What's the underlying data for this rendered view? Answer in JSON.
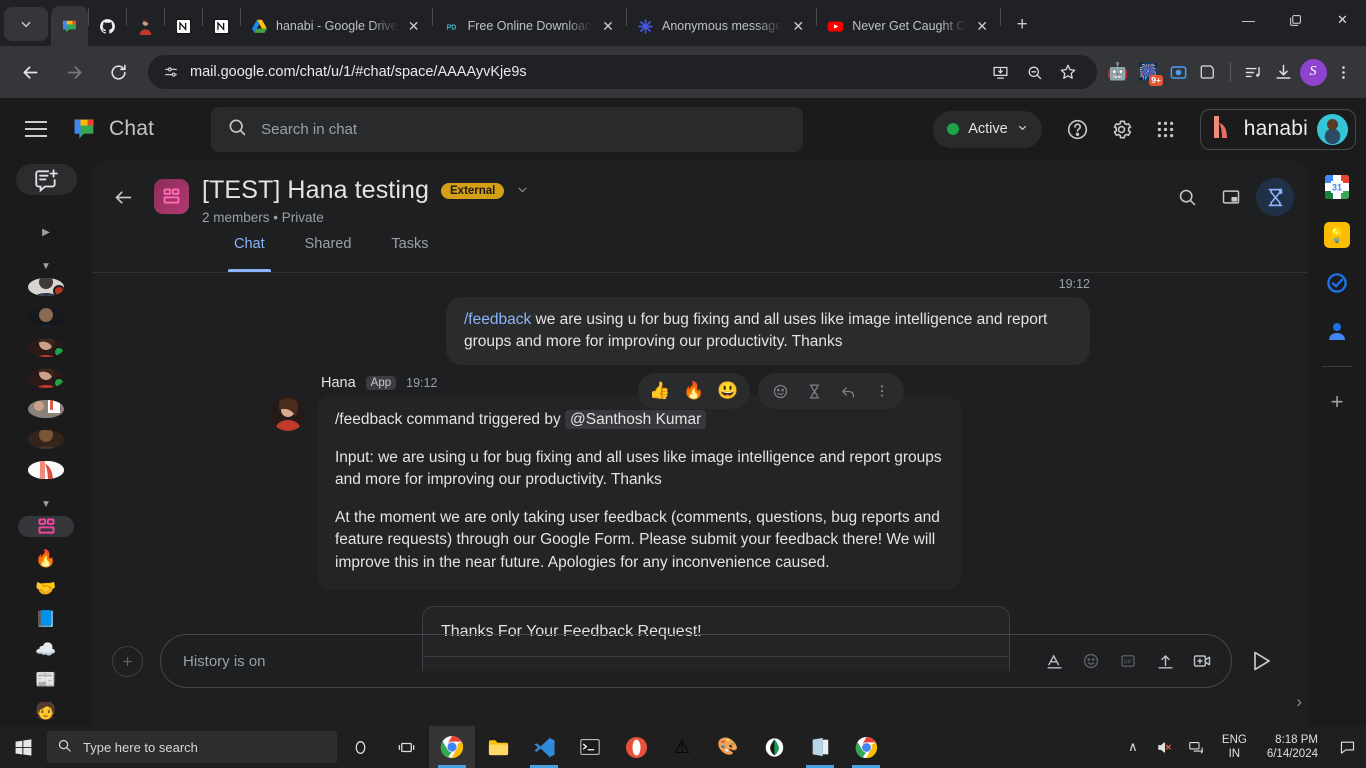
{
  "browser": {
    "tabs": [
      {
        "title": "",
        "icon": "google-chat-icon",
        "active": true,
        "closable": false
      },
      {
        "title": "",
        "icon": "github-icon",
        "active": false,
        "closable": false
      },
      {
        "title": "",
        "icon": "person-photo-icon",
        "active": false,
        "closable": false
      },
      {
        "title": "",
        "icon": "notion-icon",
        "active": false,
        "closable": false
      },
      {
        "title": "",
        "icon": "notion-icon",
        "active": false,
        "closable": false
      },
      {
        "title": "hanabi - Google Drive",
        "icon": "google-drive-icon",
        "active": false,
        "closable": true
      },
      {
        "title": "Free Online Download",
        "icon": "pdf-icon",
        "active": false,
        "closable": true
      },
      {
        "title": "Anonymous message",
        "icon": "asterisk-icon",
        "active": false,
        "closable": true
      },
      {
        "title": "Never Get Caught O",
        "icon": "youtube-icon",
        "active": false,
        "closable": true
      }
    ],
    "new_tab_label": "+",
    "window_controls": {
      "minimize": "—",
      "maximize": "❐",
      "close": "✕"
    },
    "url": "mail.google.com/chat/u/1/#chat/space/AAAAyvKje9s",
    "url_host": "mail.google.com",
    "url_path": "/chat/u/1/#chat/space/AAAAyvKje9s",
    "toolbar_icons": [
      "back-icon",
      "forward-icon",
      "reload-icon",
      "site-settings-icon",
      "install-app-icon",
      "zoom-out-icon",
      "bookmark-star-icon",
      "extension-robot-icon",
      "extension-fireworks-icon",
      "extension-screencast-icon",
      "extension-pocket-icon",
      "media-playlist-icon",
      "downloads-icon",
      "profile-icon",
      "chrome-menu-icon"
    ],
    "extension_badge": "9+",
    "profile_initial": "S"
  },
  "chat_header": {
    "menu_icon": "hamburger-menu-icon",
    "brand": "Chat",
    "search_placeholder": "Search in chat",
    "status": "Active",
    "status_color": "#1ea446",
    "help_icon": "help-icon",
    "settings_icon": "gear-icon",
    "apps_icon": "google-apps-grid-icon",
    "workspace_name": "hanabi"
  },
  "rail": {
    "compose_label": "compose-icon",
    "expand_icon": "▶",
    "collapse_icon": "▼",
    "people": [
      {
        "name": "person-1",
        "presence": "#c5321f"
      },
      {
        "name": "person-2",
        "presence": ""
      },
      {
        "name": "person-3",
        "presence": "#1ea446"
      },
      {
        "name": "person-4",
        "presence": "#1ea446"
      },
      {
        "name": "person-5",
        "presence": ""
      },
      {
        "name": "person-6",
        "presence": ""
      },
      {
        "name": "person-7",
        "presence": ""
      }
    ],
    "spaces": [
      {
        "glyph": "",
        "name": "space-hana-testing",
        "selected": true
      },
      {
        "glyph": "🔥",
        "name": "space-fire",
        "selected": false
      },
      {
        "glyph": "🤝",
        "name": "space-handshake",
        "selected": false
      },
      {
        "glyph": "📘",
        "name": "space-book",
        "selected": false
      },
      {
        "glyph": "☁️",
        "name": "space-cloud",
        "selected": false
      },
      {
        "glyph": "📰",
        "name": "space-news",
        "selected": false
      },
      {
        "glyph": "🧑",
        "name": "space-person",
        "selected": false
      }
    ]
  },
  "space": {
    "back_icon": "back-arrow-icon",
    "title": "[TEST] Hana testing",
    "badge": "External",
    "members": "2 members",
    "separator": "•",
    "visibility": "Private",
    "subtitle": "2 members  •  Private",
    "tabs": [
      {
        "label": "Chat",
        "selected": true
      },
      {
        "label": "Shared",
        "selected": false
      },
      {
        "label": "Tasks",
        "selected": false
      }
    ],
    "header_icons": [
      "search-icon",
      "picture-in-picture-icon",
      "huddle-icon"
    ]
  },
  "messages": {
    "outgoing": {
      "time": "19:12",
      "command": "/feedback",
      "text": " we are using u for bug fixing and all uses like image intelligence and report groups and more for improving our productivity. Thanks"
    },
    "incoming": {
      "sender": "Hana",
      "app_tag": "App",
      "time": "19:12",
      "trigger_prefix": "/feedback command triggered by",
      "mention": "@Santhosh Kumar",
      "paragraph_1": "Input: we are using u for bug fixing and all uses like image intelligence and report groups and more for improving our productivity. Thanks",
      "paragraph_2": "At the moment we are only taking user feedback (comments, questions, bug reports and feature requests) through our Google Form. Please submit your feedback there! We will improve this in the near future. Apologies for any inconvenience caused."
    },
    "hover_toolbar": {
      "quick_reactions": [
        "👍",
        "🔥",
        "😃"
      ],
      "actions": [
        "add-reaction-icon",
        "thread-icon",
        "reply-icon",
        "more-options-icon"
      ]
    },
    "card": {
      "title": "Thanks For Your Feedback Request!"
    }
  },
  "compose": {
    "add_icon": "plus-circle-icon",
    "placeholder": "History is on",
    "icons": [
      "format-text-icon",
      "emoji-icon",
      "gif-icon",
      "upload-icon",
      "video-icon"
    ],
    "send_icon": "send-icon",
    "expand_icon": "›"
  },
  "google_side_panel": {
    "items": [
      {
        "name": "google-calendar-icon",
        "glyph": "31"
      },
      {
        "name": "google-keep-icon",
        "glyph": "💡"
      },
      {
        "name": "google-tasks-icon",
        "glyph": "✓"
      },
      {
        "name": "google-contacts-icon",
        "glyph": "👤"
      }
    ],
    "add_label": "+"
  },
  "taskbar": {
    "start_icon": "windows-start-icon",
    "search_placeholder": "Type here to search",
    "buttons": [
      {
        "name": "cortana-icon",
        "glyph": "○"
      },
      {
        "name": "task-view-icon",
        "glyph": "⧉"
      },
      {
        "name": "chrome-icon",
        "glyph": "",
        "focused": true,
        "running": true
      },
      {
        "name": "file-explorer-icon",
        "glyph": "",
        "running": false
      },
      {
        "name": "vs-code-icon",
        "glyph": "",
        "running": true
      },
      {
        "name": "command-prompt-icon",
        "glyph": "",
        "running": false
      },
      {
        "name": "opera-icon",
        "glyph": "",
        "running": false
      },
      {
        "name": "vlc-icon",
        "glyph": "",
        "running": false
      },
      {
        "name": "paint-icon",
        "glyph": "",
        "running": false
      },
      {
        "name": "mongodb-icon",
        "glyph": "",
        "running": false
      },
      {
        "name": "word-icon",
        "glyph": "",
        "running": true
      },
      {
        "name": "chrome2-icon",
        "glyph": "",
        "running": true
      }
    ],
    "tray": {
      "chevron": "∧",
      "volume_icon": "volume-muted-icon",
      "network_icon": "network-icon",
      "language_line1": "ENG",
      "language_line2": "IN",
      "time": "8:18 PM",
      "date": "6/14/2024",
      "notification_icon": "notification-icon"
    }
  },
  "colors": {
    "accent_blue": "#8ab4f8",
    "badge_gold": "#d4a017",
    "presence_green": "#1ea446",
    "brand_coral": "#f08a7a",
    "bg_window": "#202124",
    "bg_panel": "#1e1f20"
  }
}
